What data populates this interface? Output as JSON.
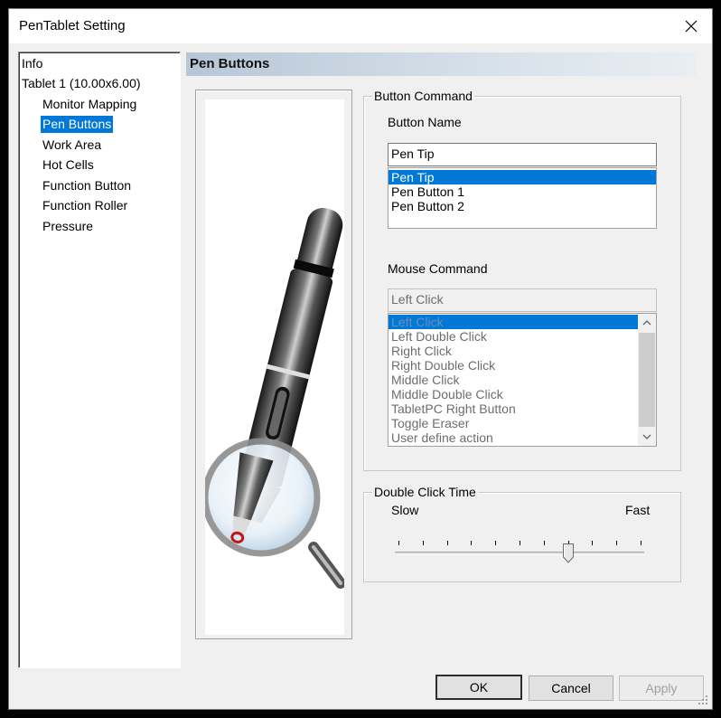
{
  "window": {
    "title": "PenTablet Setting"
  },
  "tree": {
    "items": [
      {
        "label": "Info"
      },
      {
        "label": "Tablet  1 (10.00x6.00)"
      },
      {
        "label": "Monitor Mapping"
      },
      {
        "label": "Pen Buttons"
      },
      {
        "label": "Work Area"
      },
      {
        "label": "Hot Cells"
      },
      {
        "label": "Function Button"
      },
      {
        "label": "Function Roller"
      },
      {
        "label": "Pressure"
      }
    ],
    "selected": "Pen Buttons"
  },
  "page": {
    "header": "Pen Buttons"
  },
  "button_command": {
    "legend": "Button Command",
    "button_name_label": "Button Name",
    "button_name_value": "Pen Tip",
    "button_list": [
      "Pen Tip",
      "Pen Button 1",
      "Pen Button 2"
    ],
    "selected_button": "Pen Tip",
    "mouse_command_label": "Mouse Command",
    "mouse_command_value": "Left Click",
    "mouse_list": [
      "Left Click",
      "Left Double Click",
      "Right Click",
      "Right Double Click",
      "Middle Click",
      "Middle Double Click",
      "TabletPC Right Button",
      "Toggle Eraser",
      "User define action"
    ],
    "selected_mouse": "Left Click"
  },
  "double_click": {
    "legend": "Double Click Time",
    "slow_label": "Slow",
    "fast_label": "Fast",
    "tick_count": 11,
    "value_fraction": 0.7
  },
  "buttons": {
    "ok": "OK",
    "cancel": "Cancel",
    "apply": "Apply"
  },
  "colors": {
    "selection": "#0078d7",
    "header_gradient_start": "#b7c6d6"
  }
}
